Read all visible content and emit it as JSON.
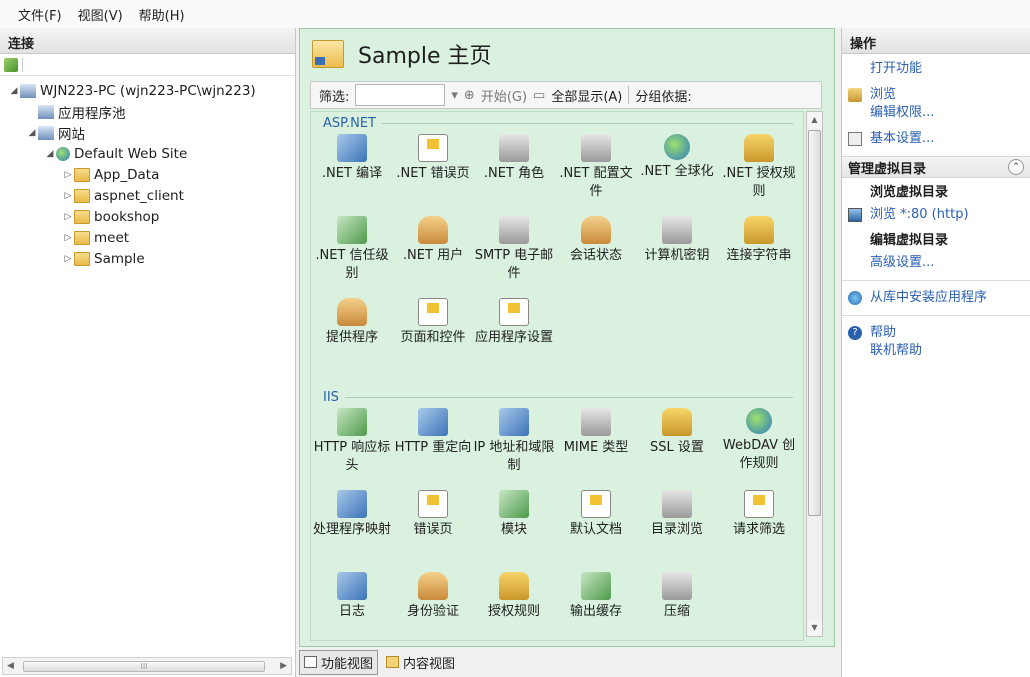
{
  "menu": [
    "文件(F)",
    "视图(V)",
    "帮助(H)"
  ],
  "connections": {
    "title": "连接",
    "tree": [
      {
        "label": "WJN223-PC (wjn223-PC\\wjn223)",
        "level": 0,
        "toggle": "◢",
        "icon": "server-icon"
      },
      {
        "label": "应用程序池",
        "level": 1,
        "toggle": "",
        "icon": "app-pool-icon"
      },
      {
        "label": "网站",
        "level": 1,
        "toggle": "◢",
        "icon": "sites-icon"
      },
      {
        "label": "Default Web Site",
        "level": 2,
        "toggle": "◢",
        "icon": "globe-icon"
      },
      {
        "label": "App_Data",
        "level": 3,
        "toggle": "▷",
        "icon": "folder-icon"
      },
      {
        "label": "aspnet_client",
        "level": 3,
        "toggle": "▷",
        "icon": "folder-icon"
      },
      {
        "label": "bookshop",
        "level": 3,
        "toggle": "▷",
        "icon": "folder-icon"
      },
      {
        "label": "meet",
        "level": 3,
        "toggle": "▷",
        "icon": "folder-icon"
      },
      {
        "label": "Sample",
        "level": 3,
        "toggle": "▷",
        "icon": "virtual-dir-icon"
      }
    ],
    "hscroll_left": "◀",
    "hscroll_right": "▶",
    "hscroll_grip": "III"
  },
  "page": {
    "title": "Sample 主页",
    "filter_label": "筛选:",
    "filter_value": "",
    "start_label": "开始(G)",
    "show_all_label": "全部显示(A)",
    "group_by_label": "分组依据:",
    "groups": [
      {
        "name": "ASP.NET",
        "features": [
          [
            ".NET 编译",
            "blue"
          ],
          [
            ".NET 错误页",
            "doc"
          ],
          [
            ".NET 角色",
            "grey"
          ],
          [
            ".NET 配置文件",
            "grey"
          ],
          [
            ".NET 全球化",
            "globe"
          ],
          [
            ".NET 授权规则",
            "lock"
          ],
          [
            ".NET 信任级别",
            "green"
          ],
          [
            ".NET 用户",
            "user"
          ],
          [
            "SMTP 电子邮件",
            "grey"
          ],
          [
            "会话状态",
            "user"
          ],
          [
            "计算机密钥",
            "grey"
          ],
          [
            "连接字符串",
            "lock"
          ],
          [
            "提供程序",
            "user"
          ],
          [
            "页面和控件",
            "doc"
          ],
          [
            "应用程序设置",
            "doc"
          ]
        ]
      },
      {
        "name": "IIS",
        "features": [
          [
            "HTTP 响应标头",
            "green"
          ],
          [
            "HTTP 重定向",
            "blue"
          ],
          [
            "IP 地址和域限制",
            "blue"
          ],
          [
            "MIME 类型",
            "grey"
          ],
          [
            "SSL 设置",
            "lock"
          ],
          [
            "WebDAV 创作规则",
            "globe"
          ],
          [
            "处理程序映射",
            "blue"
          ],
          [
            "错误页",
            "doc"
          ],
          [
            "模块",
            "green"
          ],
          [
            "默认文档",
            "doc"
          ],
          [
            "目录浏览",
            "grey"
          ],
          [
            "请求筛选",
            "doc"
          ],
          [
            "日志",
            "blue"
          ],
          [
            "身份验证",
            "user"
          ],
          [
            "授权规则",
            "lock"
          ],
          [
            "输出缓存",
            "green"
          ],
          [
            "压缩",
            "grey"
          ]
        ]
      }
    ]
  },
  "bottom_tabs": {
    "feature_view": "功能视图",
    "content_view": "内容视图"
  },
  "actions": {
    "title": "操作",
    "open_feature": "打开功能",
    "browse": "浏览",
    "edit_permissions": "编辑权限...",
    "basic_settings": "基本设置...",
    "manage_vdir": "管理虚拟目录",
    "browse_vdir": "浏览虚拟目录",
    "browse_port": "浏览 *:80 (http)",
    "edit_vdir": "编辑虚拟目录",
    "advanced_settings": "高级设置...",
    "install_from_gallery": "从库中安装应用程序",
    "help": "帮助",
    "online_help": "联机帮助",
    "collapse_symbol": "⌃"
  }
}
